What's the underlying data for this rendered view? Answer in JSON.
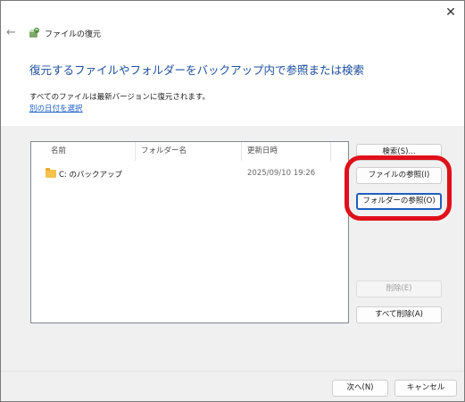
{
  "window": {
    "close_glyph": "✕"
  },
  "header": {
    "back_glyph": "←",
    "app_title": "ファイルの復元",
    "heading": "復元するファイルやフォルダーをバックアップ内で参照または検索",
    "description": "すべてのファイルは最新バージョンに復元されます。",
    "alt_date_link": "別の日付を選択"
  },
  "list": {
    "columns": [
      "名前",
      "フォルダー名",
      "更新日時"
    ],
    "rows": [
      {
        "name": "C: のバックアップ",
        "folder": "",
        "modified": "2025/09/10 19:26"
      }
    ]
  },
  "buttons": {
    "search": "検索(S)...",
    "browse_files": "ファイルの参照(I)",
    "browse_folders": "フォルダーの参照(O)",
    "remove": "削除(E)",
    "remove_all": "すべて削除(A)",
    "next": "次へ(N)",
    "cancel": "キャンセル"
  },
  "colors": {
    "heading": "#1c4fa0",
    "link": "#1a5fc8",
    "highlight": "#e0101a",
    "folder": "#f5c24c"
  }
}
